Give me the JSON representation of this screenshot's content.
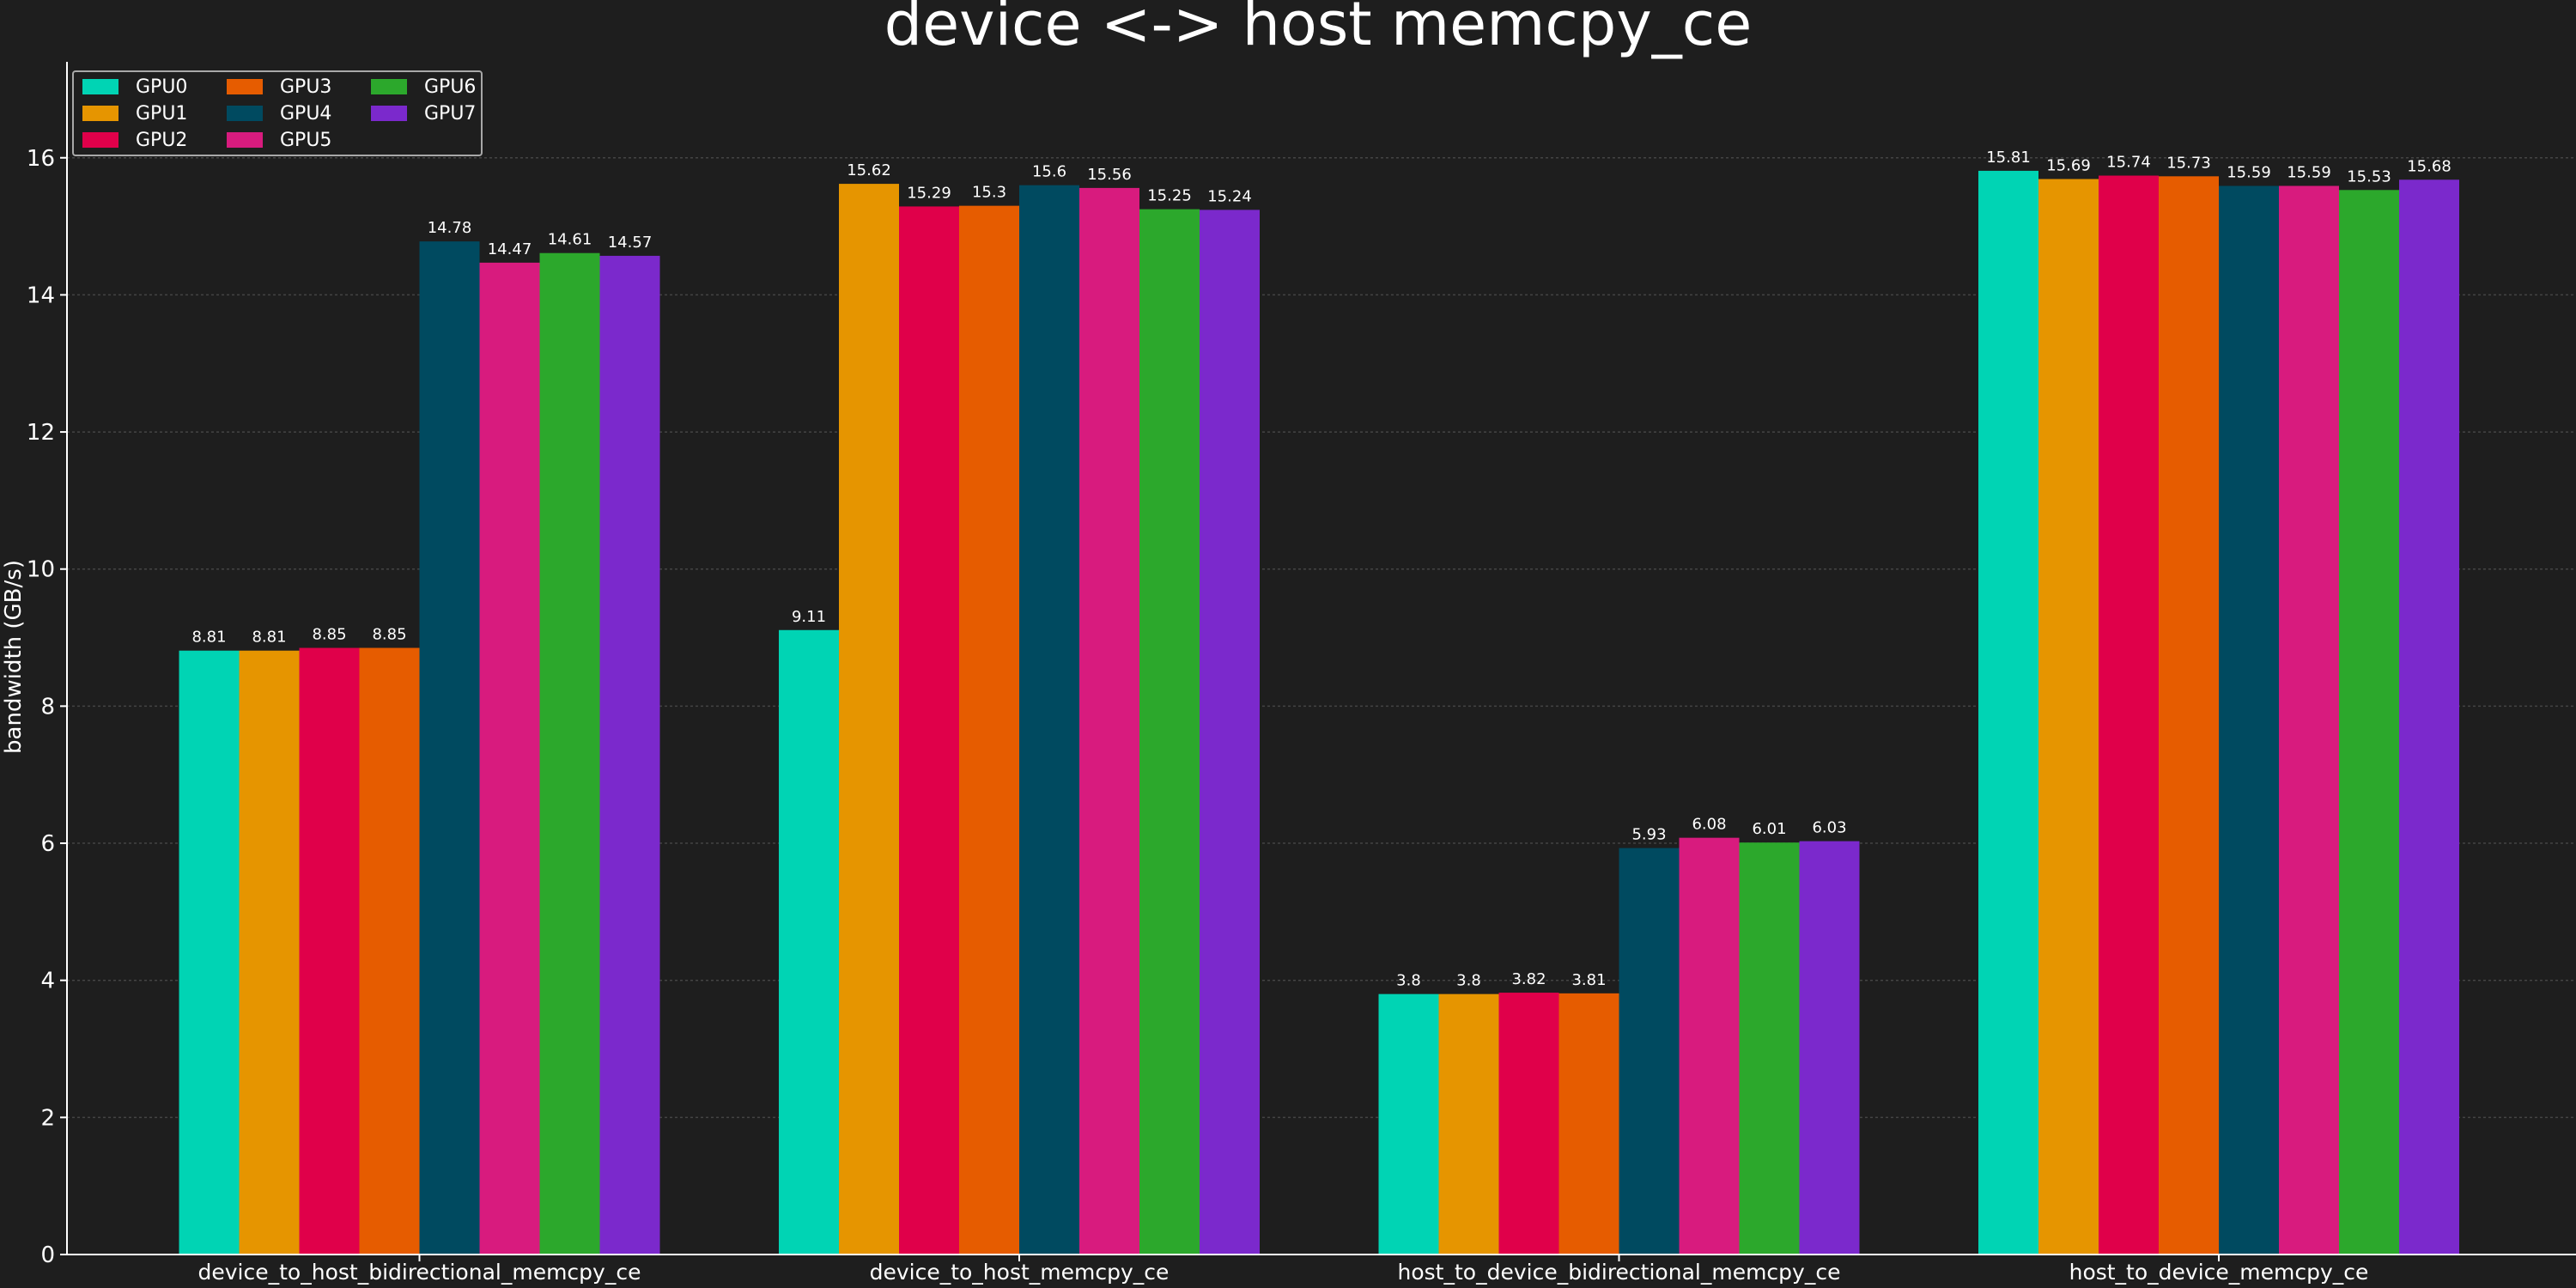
{
  "chart_data": {
    "type": "bar",
    "title": "device <-> host memcpy_ce",
    "xlabel": "",
    "ylabel": "bandwidth (GB/s)",
    "ylim": [
      0,
      17.4
    ],
    "yticks": [
      0,
      2,
      4,
      6,
      8,
      10,
      12,
      14,
      16
    ],
    "grid": true,
    "legend_position": "top-left",
    "categories": [
      "device_to_host_bidirectional_memcpy_ce",
      "device_to_host_memcpy_ce",
      "host_to_device_bidirectional_memcpy_ce",
      "host_to_device_memcpy_ce"
    ],
    "series": [
      {
        "name": "GPU0",
        "color": "#00d4b4",
        "values": [
          8.81,
          9.11,
          3.8,
          15.81
        ]
      },
      {
        "name": "GPU1",
        "color": "#e69500",
        "values": [
          8.81,
          15.62,
          3.8,
          15.69
        ]
      },
      {
        "name": "GPU2",
        "color": "#e0004a",
        "values": [
          8.85,
          15.29,
          3.82,
          15.74
        ]
      },
      {
        "name": "GPU3",
        "color": "#e65c00",
        "values": [
          8.85,
          15.3,
          3.81,
          15.73
        ]
      },
      {
        "name": "GPU4",
        "color": "#004a60",
        "values": [
          14.78,
          15.6,
          5.93,
          15.59
        ]
      },
      {
        "name": "GPU5",
        "color": "#d81b7e",
        "values": [
          14.47,
          15.56,
          6.08,
          15.59
        ]
      },
      {
        "name": "GPU6",
        "color": "#2ca82c",
        "values": [
          14.61,
          15.25,
          6.01,
          15.53
        ]
      },
      {
        "name": "GPU7",
        "color": "#7b29cc",
        "values": [
          14.57,
          15.24,
          6.03,
          15.68
        ]
      }
    ]
  }
}
